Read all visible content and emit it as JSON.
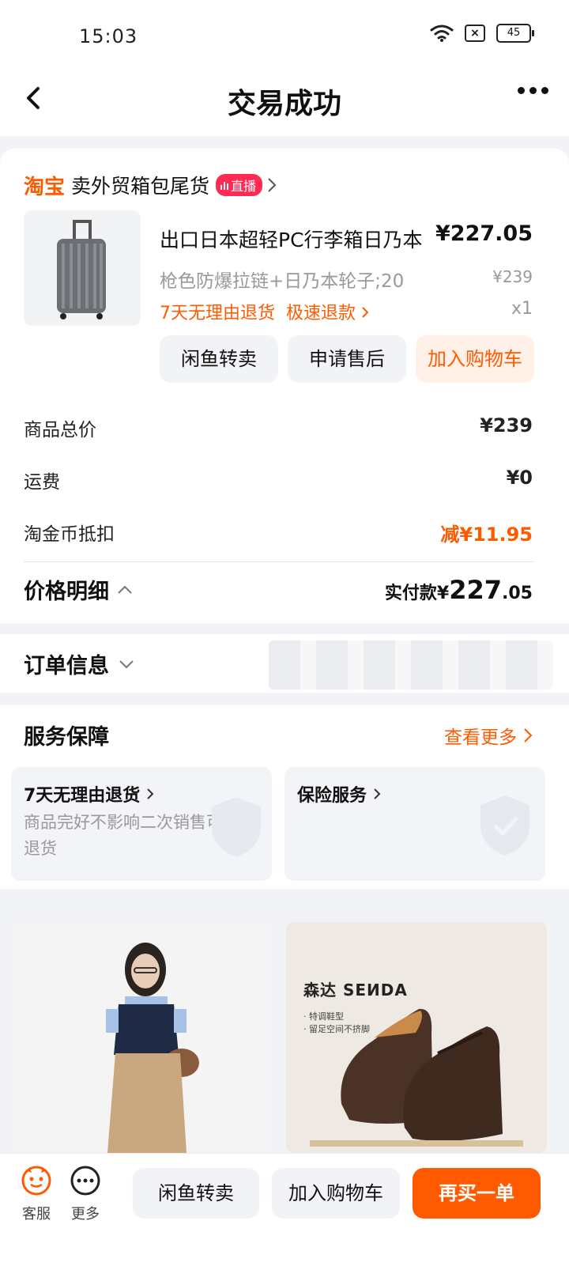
{
  "status_bar": {
    "time": "15:03",
    "battery": "45"
  },
  "nav": {
    "title": "交易成功"
  },
  "shop": {
    "logo": "淘宝",
    "name": "卖外贸箱包尾货",
    "live_label": "直播"
  },
  "product": {
    "title": "出口日本超轻PC行李箱日乃本",
    "price": "¥227.05",
    "spec": "枪色防爆拉链+日乃本轮子;20",
    "original_price": "¥239",
    "service_return": "7天无理由退货",
    "service_refund": "极速退款",
    "quantity": "x1"
  },
  "actions": {
    "resell": "闲鱼转卖",
    "after_sale": "申请售后",
    "add_cart": "加入购物车"
  },
  "price_rows": [
    {
      "label": "商品总价",
      "value": "¥239"
    },
    {
      "label": "运费",
      "value": "¥0"
    },
    {
      "label": "淘金币抵扣",
      "value": "减¥11.95"
    }
  ],
  "price_detail": {
    "title": "价格明细",
    "paid_label": "实付款",
    "paid_currency": "¥",
    "paid_int": "227",
    "paid_dec": ".05"
  },
  "order_info": {
    "title": "订单信息"
  },
  "service": {
    "title": "服务保障",
    "more": "查看更多",
    "items": [
      {
        "title": "7天无理由退货",
        "desc": "商品完好不影响二次销售可申请退货"
      },
      {
        "title": "保险服务",
        "desc": ""
      }
    ]
  },
  "recommend": {
    "right_brand": "森达 SEИDA",
    "right_tagline_1": "· 特调鞋型",
    "right_tagline_2": "· 留足空间不挤脚"
  },
  "bottom": {
    "service_label": "客服",
    "more_label": "更多",
    "resell": "闲鱼转卖",
    "add_cart": "加入购物车",
    "buy_again": "再买一单"
  },
  "colors": {
    "accent": "#ff5a00",
    "live_badge": "#ff2b55",
    "background": "#f2f3f7"
  }
}
